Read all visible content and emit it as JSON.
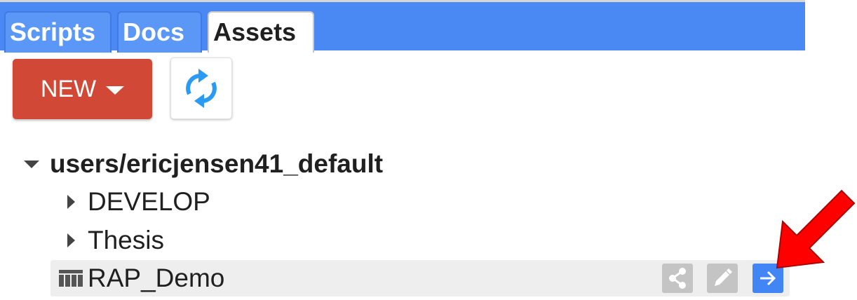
{
  "tabs": [
    {
      "label": "Scripts",
      "active": false
    },
    {
      "label": "Docs",
      "active": false
    },
    {
      "label": "Assets",
      "active": true
    }
  ],
  "toolbar": {
    "new_label": "NEW",
    "new_icon": "caret-down-icon",
    "refresh_icon": "refresh-icon"
  },
  "tree": {
    "root": {
      "label": "users/ericjensen41_default",
      "expanded": true,
      "icon": "triangle-down-icon"
    },
    "folders": [
      {
        "label": "DEVELOP",
        "expanded": false,
        "icon": "triangle-right-icon"
      },
      {
        "label": "Thesis",
        "expanded": false,
        "icon": "triangle-right-icon"
      }
    ],
    "asset": {
      "label": "RAP_Demo",
      "icon": "table-icon",
      "actions": [
        "share-icon",
        "edit-icon",
        "arrow-right-icon"
      ]
    }
  },
  "colors": {
    "tabbar": "#4a89f3",
    "new_button": "#d14836",
    "refresh_icon": "#2b9af3",
    "import_button": "#4285f4",
    "action_disabled": "#c4c4c4",
    "annotation_arrow": "#ff0000"
  }
}
